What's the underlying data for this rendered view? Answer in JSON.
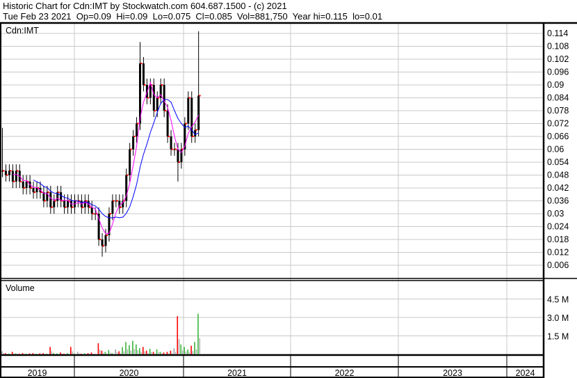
{
  "header": {
    "title": "Historic Chart for Cdn:IMT by Stockwatch.com 604.687.1500 - (c) 2021",
    "quote": "Tue Feb 23 2021  Op=0.09  Hi=0.09  Lo=0.075  Cl=0.085  Vol=881,750  Year hi=0.115  lo=0.01"
  },
  "chart_data": [
    {
      "type": "ohlc",
      "title": "Cdn:IMT",
      "ylim": [
        0,
        0.12
      ],
      "yticks": [
        "0.114",
        "0.108",
        "0.102",
        "0.096",
        "0.09",
        "0.084",
        "0.078",
        "0.072",
        "0.066",
        "0.06",
        "0.054",
        "0.048",
        "0.042",
        "0.036",
        "0.03",
        "0.024",
        "0.018",
        "0.012",
        "0.006"
      ],
      "xticks": [
        "2019",
        "2020",
        "2021",
        "2022",
        "2023",
        "2024"
      ],
      "moving_averages": [
        {
          "name": "short MA",
          "color": "#ff00ff",
          "period": 4
        },
        {
          "name": "long MA",
          "color": "#0000ff",
          "period": 10
        }
      ],
      "closes": [
        0.05,
        0.048,
        0.05,
        0.045,
        0.05,
        0.045,
        0.042,
        0.045,
        0.042,
        0.04,
        0.042,
        0.04,
        0.036,
        0.04,
        0.033,
        0.036,
        0.04,
        0.036,
        0.033,
        0.036,
        0.033,
        0.036,
        0.036,
        0.033,
        0.036,
        0.033,
        0.03,
        0.03,
        0.018,
        0.015,
        0.02,
        0.03,
        0.036,
        0.036,
        0.033,
        0.036,
        0.048,
        0.06,
        0.066,
        0.072,
        0.1,
        0.09,
        0.084,
        0.09,
        0.078,
        0.084,
        0.09,
        0.078,
        0.066,
        0.06,
        0.06,
        0.054,
        0.06,
        0.072,
        0.084,
        0.066,
        0.069,
        0.085
      ],
      "special_highs": {
        "0": 0.07,
        "40": 0.11,
        "57": 0.115
      },
      "special_lows": {
        "29": 0.01,
        "51": 0.045
      }
    },
    {
      "type": "bar",
      "title": "Volume",
      "ylim": [
        0,
        5.0
      ],
      "unit": "M",
      "yticks": [
        "4.5 M",
        "3.0 M",
        "1.5 M"
      ],
      "values": [
        0.25,
        0.1,
        0.05,
        0.2,
        0.08,
        0.05,
        0.1,
        0.06,
        0.08,
        0.1,
        0.05,
        0.08,
        0.1,
        0.05,
        0.6,
        0.1,
        0.08,
        0.15,
        0.05,
        0.1,
        0.6,
        0.08,
        0.2,
        0.05,
        0.1,
        0.1,
        0.15,
        0.05,
        0.9,
        0.3,
        0.2,
        0.35,
        0.1,
        0.4,
        0.25,
        0.6,
        1.0,
        0.75,
        1.1,
        0.8,
        0.5,
        0.6,
        0.3,
        0.45,
        0.2,
        0.4,
        0.2,
        0.15,
        0.2,
        0.3,
        0.5,
        3.1,
        0.8,
        0.6,
        0.4,
        0.7,
        1.0,
        3.3
      ]
    }
  ],
  "colors": {
    "up": "#3cb43c",
    "down": "#ff0000",
    "flat": "#a0a0a0",
    "grid": "#c8c8c8"
  }
}
